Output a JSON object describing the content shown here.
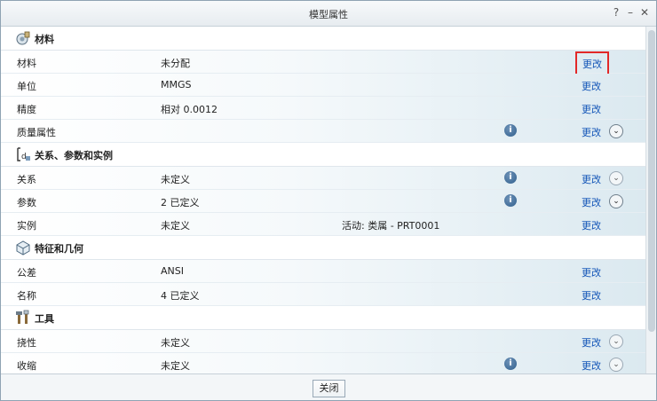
{
  "window": {
    "title": "模型属性",
    "controls": {
      "help": "?",
      "minimize": "–",
      "maximize": "□",
      "close": "✕"
    }
  },
  "sections": {
    "materials": {
      "title": "材料",
      "icon": "material-icon",
      "rows": [
        {
          "label": "材料",
          "value": "未分配",
          "edit": "更改"
        },
        {
          "label": "单位",
          "value": "MMGS",
          "edit": "更改"
        },
        {
          "label": "精度",
          "value": "相对 0.0012",
          "edit": "更改"
        },
        {
          "label": "质量属性",
          "value": "",
          "edit": "更改"
        }
      ]
    },
    "relations": {
      "title": "关系、参数和实例",
      "icon": "relations-icon",
      "rows": [
        {
          "label": "关系",
          "value": "未定义",
          "edit": "更改"
        },
        {
          "label": "参数",
          "value": "2 已定义",
          "edit": "更改"
        },
        {
          "label": "实例",
          "value": "未定义",
          "extra": "活动: 类属 - PRT0001",
          "edit": "更改"
        }
      ]
    },
    "features": {
      "title": "特征和几何",
      "icon": "features-icon",
      "rows": [
        {
          "label": "公差",
          "value": "ANSI",
          "edit": "更改"
        },
        {
          "label": "名称",
          "value": "4 已定义",
          "edit": "更改"
        }
      ]
    },
    "tools": {
      "title": "工具",
      "icon": "tools-icon",
      "rows": [
        {
          "label": "挠性",
          "value": "未定义",
          "edit": "更改"
        },
        {
          "label": "收缩",
          "value": "未定义",
          "edit": "更改"
        }
      ]
    }
  },
  "glyphs": {
    "info": "i",
    "expand": "⌄"
  },
  "footer": {
    "close_label": "关闭"
  },
  "colors": {
    "link": "#1456b8",
    "highlight_border": "#e22828",
    "info_icon": "#2f5f8d"
  }
}
